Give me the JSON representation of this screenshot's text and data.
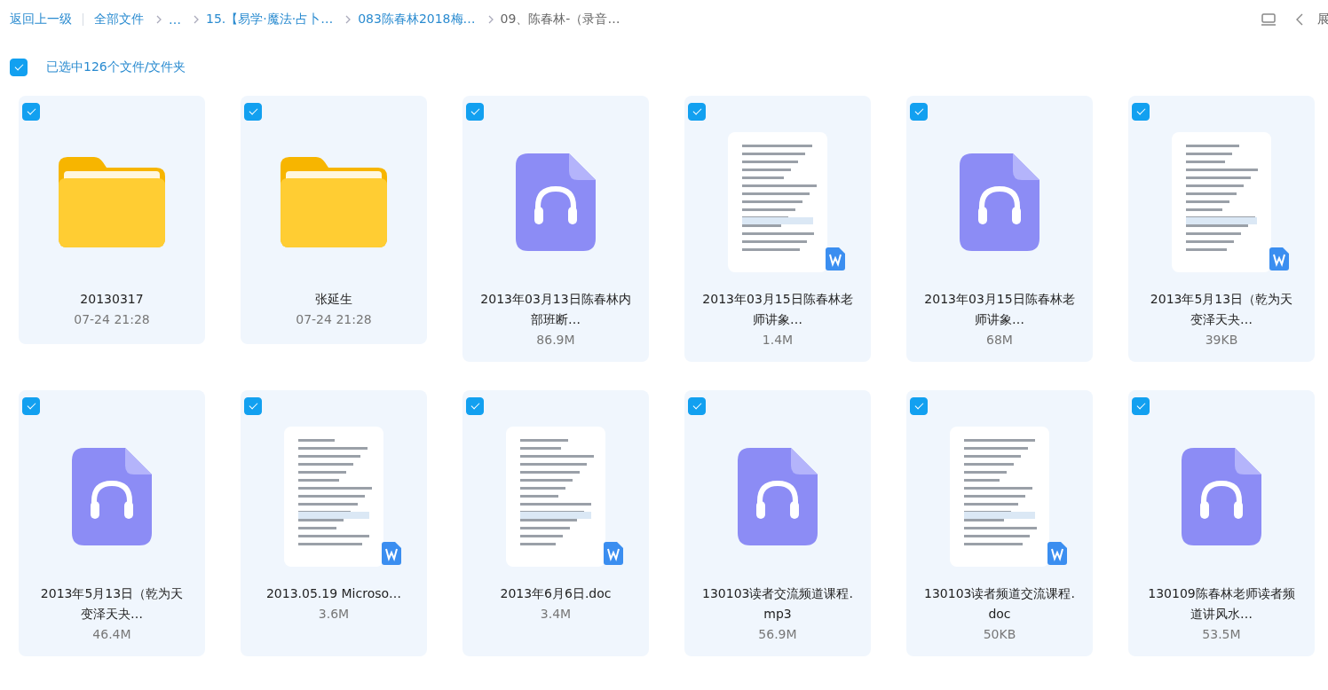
{
  "toolbar": {
    "back": "返回上一级",
    "breadcrumbs": [
      {
        "label": "全部文件",
        "current": false
      },
      {
        "label": "…",
        "current": false
      },
      {
        "label": "15.【易学·魔法·占卜…",
        "current": false
      },
      {
        "label": "083陈春林2018梅…",
        "current": false
      },
      {
        "label": "09、陈春林-（录音…",
        "current": true
      }
    ],
    "cut_label": "展"
  },
  "selection": {
    "checked": true,
    "label": "已选中126个文件/文件夹"
  },
  "files": [
    {
      "kind": "folder",
      "checked": true,
      "name": "20130317",
      "meta": "07-24 21:28"
    },
    {
      "kind": "folder",
      "checked": true,
      "name": "张延生",
      "meta": "07-24 21:28"
    },
    {
      "kind": "audio",
      "checked": true,
      "name": "2013年03月13日陈春林内部班断…",
      "meta": "86.9M"
    },
    {
      "kind": "doc",
      "checked": true,
      "name": "2013年03月15日陈春林老师讲象…",
      "meta": "1.4M"
    },
    {
      "kind": "audio",
      "checked": true,
      "name": "2013年03月15日陈春林老师讲象…",
      "meta": "68M"
    },
    {
      "kind": "doc",
      "checked": true,
      "name": "2013年5月13日（乾为天变泽天夬…",
      "meta": "39KB"
    },
    {
      "kind": "audio",
      "checked": true,
      "name": "2013年5月13日（乾为天变泽天夬…",
      "meta": "46.4M"
    },
    {
      "kind": "doc",
      "checked": true,
      "name": "2013.05.19 Microso…",
      "meta": "3.6M"
    },
    {
      "kind": "doc",
      "checked": true,
      "name": "2013年6月6日.doc",
      "meta": "3.4M"
    },
    {
      "kind": "audio",
      "checked": true,
      "name": "130103读者交流频道课程.mp3",
      "meta": "56.9M"
    },
    {
      "kind": "doc",
      "checked": true,
      "name": "130103读者频道交流课程.doc",
      "meta": "50KB"
    },
    {
      "kind": "audio",
      "checked": true,
      "name": "130109陈春林老师读者频道讲风水…",
      "meta": "53.5M"
    }
  ]
}
